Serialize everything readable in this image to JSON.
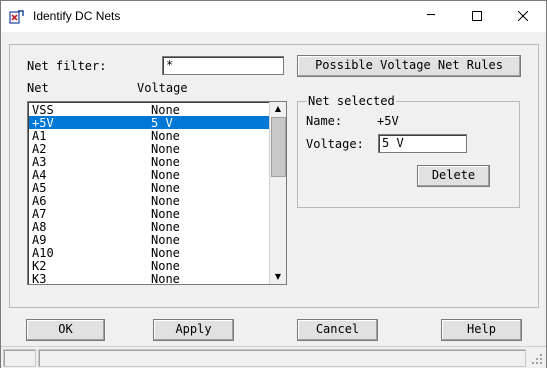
{
  "window": {
    "title": "Identify DC Nets"
  },
  "filter": {
    "label": "Net filter:",
    "value": "*"
  },
  "rules_button": "Possible Voltage Net Rules",
  "list": {
    "header_net": "Net",
    "header_voltage": "Voltage",
    "rows": [
      {
        "net": "VSS",
        "voltage": "None"
      },
      {
        "net": "+5V",
        "voltage": "5 V"
      },
      {
        "net": "A1",
        "voltage": "None"
      },
      {
        "net": "A2",
        "voltage": "None"
      },
      {
        "net": "A3",
        "voltage": "None"
      },
      {
        "net": "A4",
        "voltage": "None"
      },
      {
        "net": "A5",
        "voltage": "None"
      },
      {
        "net": "A6",
        "voltage": "None"
      },
      {
        "net": "A7",
        "voltage": "None"
      },
      {
        "net": "A8",
        "voltage": "None"
      },
      {
        "net": "A9",
        "voltage": "None"
      },
      {
        "net": "A10",
        "voltage": "None"
      },
      {
        "net": "K2",
        "voltage": "None"
      },
      {
        "net": "K3",
        "voltage": "None"
      }
    ],
    "selected_index": 1
  },
  "net_selected": {
    "title": "Net selected",
    "name_label": "Name:",
    "name_value": "+5V",
    "voltage_label": "Voltage:",
    "voltage_value": "5 V",
    "delete_label": "Delete"
  },
  "buttons": {
    "ok": "OK",
    "apply": "Apply",
    "cancel": "Cancel",
    "help": "Help"
  },
  "colors": {
    "selection": "#0078d7",
    "face": "#f0f0f0",
    "button": "#e1e1e1"
  }
}
